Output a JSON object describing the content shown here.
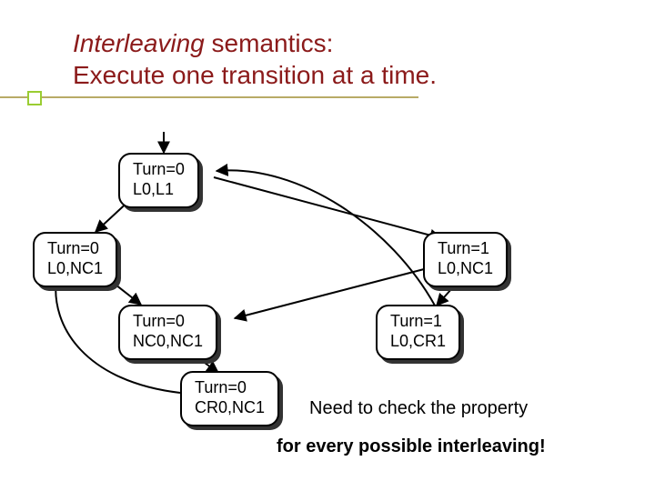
{
  "title": {
    "line1_em": "Interleaving",
    "line1_rest": " semantics:",
    "line2": "Execute one transition at a time."
  },
  "states": {
    "s1": {
      "line1": "Turn=0",
      "line2": "L0,L1"
    },
    "s2": {
      "line1": "Turn=0",
      "line2": "L0,NC1"
    },
    "s3": {
      "line1": "Turn=1",
      "line2": "L0,NC1"
    },
    "s4": {
      "line1": "Turn=0",
      "line2": "NC0,NC1"
    },
    "s5": {
      "line1": "Turn=1",
      "line2": "L0,CR1"
    },
    "s6": {
      "line1": "Turn=0",
      "line2": "CR0,NC1"
    }
  },
  "captions": {
    "c1": "Need to check the property",
    "c2": "for every possible interleaving!"
  }
}
